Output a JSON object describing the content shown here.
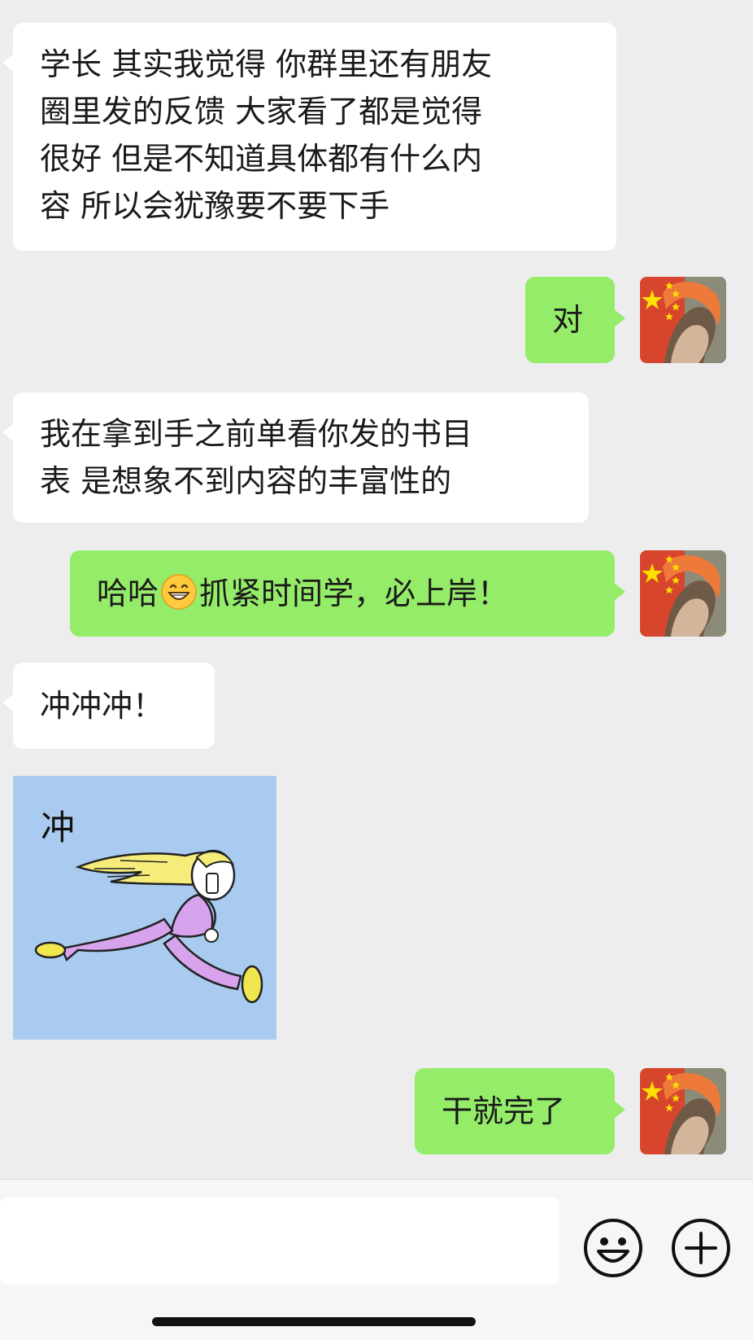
{
  "messages": [
    {
      "side": "in",
      "lines": [
        "学长 其实我觉得 你群里还有朋友",
        "圈里发的反馈 大家看了都是觉得",
        "很好 但是不知道具体都有什么内",
        "容 所以会犹豫要不要下手"
      ]
    },
    {
      "side": "out",
      "text": "对"
    },
    {
      "side": "in",
      "lines": [
        "我在拿到手之前单看你发的书目",
        "表 是想象不到内容的丰富性的"
      ]
    },
    {
      "side": "out",
      "before_emoji": "哈哈",
      "emoji": "grinning-emoji",
      "after_emoji": "抓紧时间学，必上岸！"
    },
    {
      "side": "in",
      "text": "冲冲冲！"
    },
    {
      "side": "in",
      "sticker": {
        "caption": "冲",
        "background": "#a9cbef",
        "hair": "#f5ec7a",
        "outfit": "#d6a3ec"
      }
    },
    {
      "side": "out",
      "text": "干就完了"
    }
  ],
  "avatar": {
    "icon": "china-flag-avatar-icon",
    "flag_color": "#e02f22",
    "star_color": "#ffe000"
  },
  "input_bar": {
    "text": "",
    "emoji_button": "smiley-icon",
    "more_button": "plus-icon"
  },
  "colors": {
    "chat_bg": "#ededed",
    "incoming": "#ffffff",
    "outgoing": "#95ec69"
  }
}
